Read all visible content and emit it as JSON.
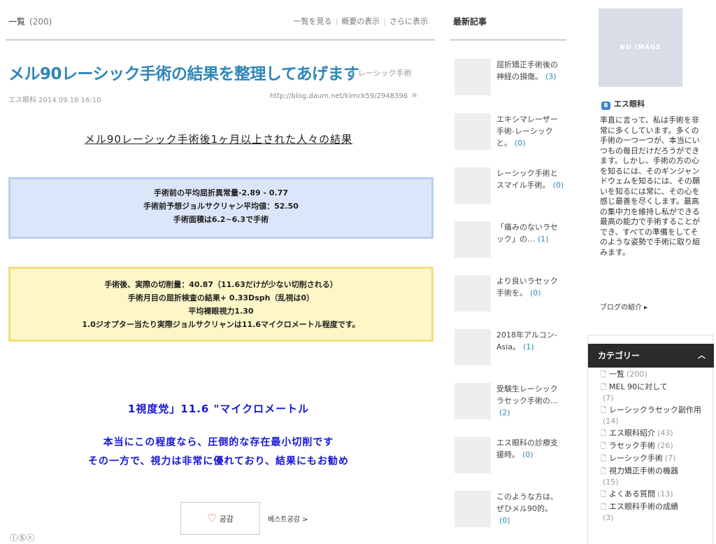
{
  "header": {
    "list_title": "一覧",
    "list_count": "(200)",
    "link_view_list": "一覧を見る",
    "link_summary": "概要の表示",
    "link_more": "さらに表示"
  },
  "post": {
    "title": "メル90レーシック手術の結果を整理してあげます",
    "category": "レーシック手術",
    "author_date": "エス眼科  2014.09.18 16:10",
    "url": "http://blog.daum.net/kimck59/2948396",
    "heading": "メル90レーシック手術後1ヶ月以上された人々の結果",
    "blue_box": [
      "手術前の平均屈折異常量-2.89 - 0.77",
      "手術前予想ジョルサクリャン平均値：52.50",
      "手術面積は6.2~6.3で手術"
    ],
    "yellow_box": [
      "手術後、実際の切削量：40.87（11.63だけが少ない切削される）",
      "手術月目の屈折検査の結果+ 0.33Dsph（乱視は0）",
      "平均裸眼視力1.30",
      "1.0ジオプター当たり実際ジョルサクリャンは11.6マイクロメートル程度です。"
    ],
    "blue_line1": "1視度党」11.6 \"マイクロメートル",
    "blue_line2": "本当にこの程度なら、圧倒的な存在最小切削です",
    "blue_line3": "その一方で、視力は非常に優れており、結果にもお勧め",
    "like_label": "공감",
    "best_link": "베스트공감 >",
    "cc_icons": "ⓘⓈⓒ"
  },
  "recent": {
    "title": "最新記事",
    "items": [
      {
        "text": "屈折矯正手術後の神経の損傷。",
        "count": "(3)"
      },
      {
        "text": "エキシマレーザー手術-レーシックと。",
        "count": "(0)"
      },
      {
        "text": "レーシック手術とスマイル手術。",
        "count": "(0)"
      },
      {
        "text": "「痛みのないラセック」の…",
        "count": "(1)"
      },
      {
        "text": "より良いラセック手術を。",
        "count": "(0)"
      },
      {
        "text": "2018年アルコン-Asia。",
        "count": "(1)"
      },
      {
        "text": "受験生レーシックラセック手術の…",
        "count": "(2)"
      },
      {
        "text": "エス眼科の診療支援時。",
        "count": "(0)"
      },
      {
        "text": "このような方は、ぜひメル90的。",
        "count": "(0)"
      }
    ]
  },
  "profile": {
    "no_image": "NO IMAGE",
    "name": "エス眼科",
    "description": "率直に言って、私は手術を非常に多くしています。多くの手術の一つ一つが、本当にいつもの毎日だけだろうができます。しかし、手術の方の心を知るには、そのギンジャンドウェムを知るには、その願いを知るには常に、その心を感じ最善を尽くします。最高の集中力を維持し私ができる最高の能力で手術することができ、すべての準備をしてそのような姿勢で手術に取り組みます。",
    "link": "ブログの紹介 ▸"
  },
  "categories": {
    "title": "カテゴリー",
    "items": [
      {
        "label": "一覧",
        "count": "(200)"
      },
      {
        "label": "MEL 90に対して",
        "count": "(7)"
      },
      {
        "label": "レーシックラセック副作用",
        "count": "(14)"
      },
      {
        "label": "エス眼科紹介",
        "count": "(43)"
      },
      {
        "label": "ラセック手術",
        "count": "(26)"
      },
      {
        "label": "レーシック手術",
        "count": "(7)"
      },
      {
        "label": "視力矯正手術の機器",
        "count": "(15)"
      },
      {
        "label": "よくある質問",
        "count": "(13)"
      },
      {
        "label": "エス眼科手術の成績",
        "count": "(3)"
      }
    ]
  }
}
